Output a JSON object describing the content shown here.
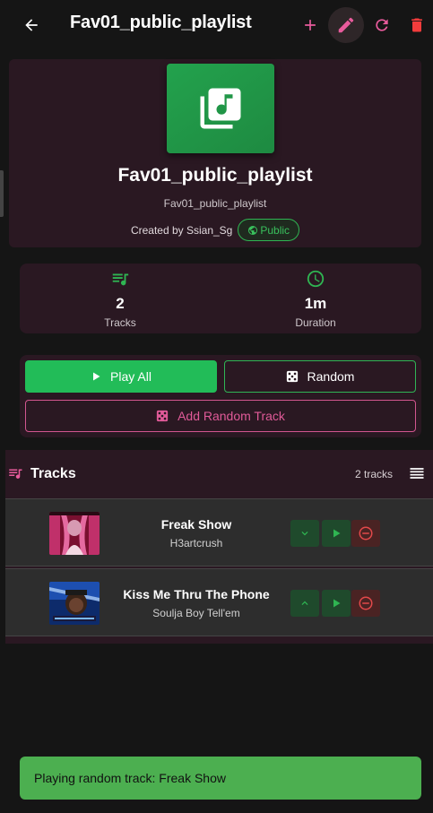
{
  "appbar": {
    "title": "Fav01_public_playlist",
    "icons": [
      "back-arrow-icon",
      "add-icon",
      "edit-pencil-icon",
      "refresh-icon",
      "delete-trash-icon"
    ],
    "accent": "#e85b9c",
    "delete_color": "#f23c3c"
  },
  "playlist": {
    "name": "Fav01_public_playlist",
    "description": "Fav01_public_playlist",
    "creator": "Created by Ssian_Sg",
    "visibility": "Public",
    "cover_color": "#23a24d"
  },
  "stats": {
    "tracks_value": "2",
    "tracks_label": "Tracks",
    "duration_value": "1m",
    "duration_label": "Duration"
  },
  "actions": {
    "play_all": "Play All",
    "random": "Random",
    "add_random": "Add Random Track"
  },
  "tracks_section": {
    "title": "Tracks",
    "count": "2 tracks",
    "items": [
      {
        "name": "Freak Show",
        "artist": "H3artcrush"
      },
      {
        "name": "Kiss Me Thru The Phone",
        "artist": "Soulja Boy Tell'em"
      }
    ]
  },
  "snackbar": {
    "message": "Playing random track: Freak Show",
    "color": "#4caf50"
  }
}
